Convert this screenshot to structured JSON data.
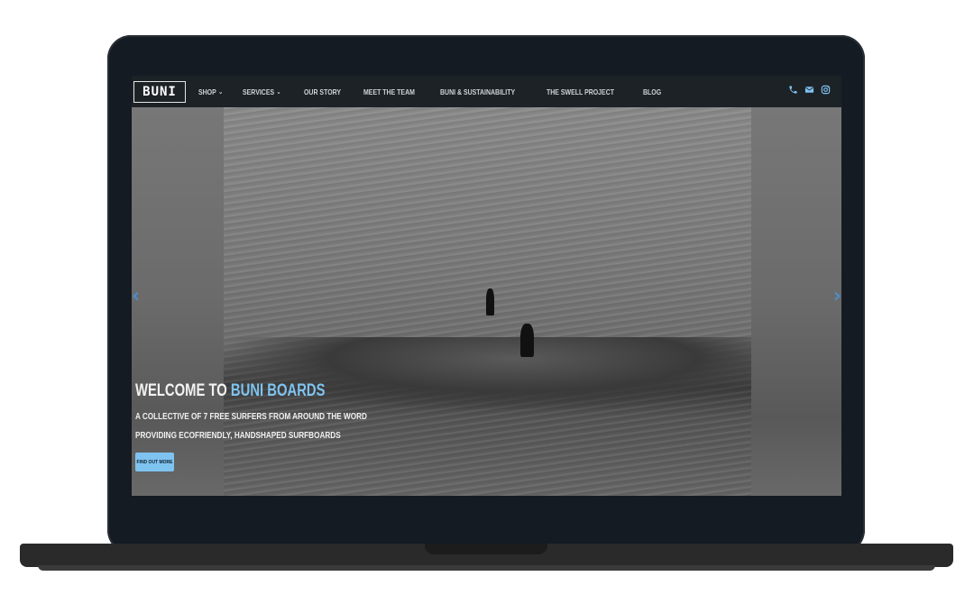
{
  "nav": {
    "logo": "BUNI",
    "items": [
      {
        "label": "SHOP",
        "has_caret": true
      },
      {
        "label": "SERVICES",
        "has_caret": true
      },
      {
        "label": "OUR STORY",
        "has_caret": false
      },
      {
        "label": "MEET THE TEAM",
        "has_caret": false
      },
      {
        "label": "BUNI & SUSTAINABILITY",
        "has_caret": false
      },
      {
        "label": "THE SWELL PROJECT",
        "has_caret": false
      },
      {
        "label": "BLOG",
        "has_caret": false
      }
    ],
    "caret": "⌄",
    "icons": [
      "phone-icon",
      "mail-icon",
      "instagram-icon"
    ],
    "icon_color": "#7fc3f0"
  },
  "hero": {
    "title_prefix": "WELCOME TO ",
    "title_accent": "BUNI BOARDS",
    "subtitle_line1": "A COLLECTIVE OF 7 FREE SURFERS FROM AROUND THE WORD",
    "subtitle_line2": "PROVIDING ECOFRIENDLY, HANDSHAPED SURFBOARDS",
    "cta_label": "FIND OUT MORE",
    "prev_arrow": "‹",
    "next_arrow": "›",
    "accent_color": "#7fc3f0"
  }
}
